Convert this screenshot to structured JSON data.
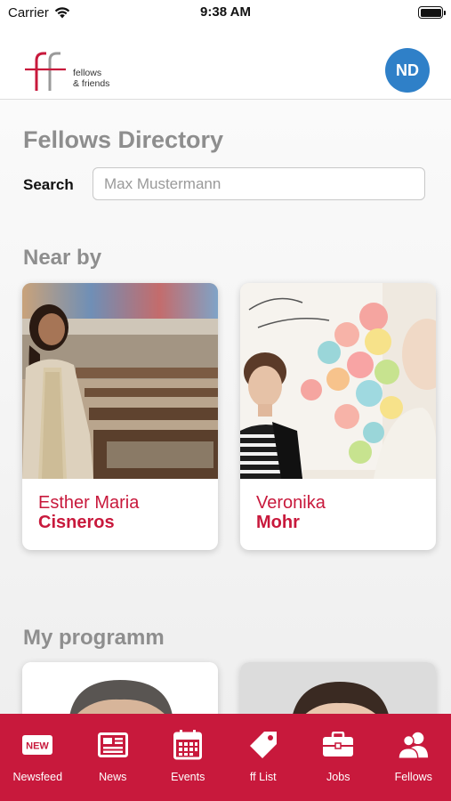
{
  "status_bar": {
    "carrier": "Carrier",
    "time": "9:38 AM"
  },
  "header": {
    "logo_line1": "fellows",
    "logo_line2": "& friends",
    "avatar_initials": "ND",
    "avatar_color": "#2f80c8"
  },
  "page": {
    "title": "Fellows Directory",
    "search_label": "Search",
    "search_placeholder": "Max Mustermann"
  },
  "nearby": {
    "title": "Near by",
    "cards": [
      {
        "first_name": "Esther Maria",
        "last_name": "Cisneros"
      },
      {
        "first_name": "Veronika",
        "last_name": "Mohr"
      }
    ]
  },
  "programm": {
    "title": "My programm"
  },
  "tabs": [
    {
      "label": "Newsfeed",
      "icon": "new-badge-icon",
      "badge": "NEW"
    },
    {
      "label": "News",
      "icon": "newspaper-icon"
    },
    {
      "label": "Events",
      "icon": "calendar-icon"
    },
    {
      "label": "ff List",
      "icon": "tag-icon"
    },
    {
      "label": "Jobs",
      "icon": "briefcase-icon"
    },
    {
      "label": "Fellows",
      "icon": "people-icon"
    }
  ],
  "colors": {
    "brand_red": "#c8193c",
    "heading_gray": "#8e8e8e"
  }
}
